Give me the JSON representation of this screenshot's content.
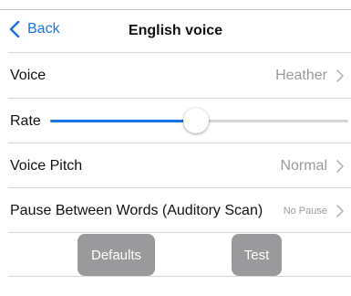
{
  "nav": {
    "back_label": "Back",
    "title": "English voice"
  },
  "rows": [
    {
      "label": "Voice",
      "value": "Heather"
    },
    {
      "label": "Rate"
    },
    {
      "label": "Voice Pitch",
      "value": "Normal"
    },
    {
      "label": "Pause Between Words (Auditory Scan)",
      "value": "No Pause"
    }
  ],
  "rate_slider": {
    "fraction": 0.49
  },
  "buttons": {
    "defaults_label": "Defaults",
    "test_label": "Test"
  },
  "colors": {
    "accent": "#1a73e8",
    "button_bg": "#9a9a9d",
    "value_gray": "#9a9a9a"
  },
  "icons": {
    "back": "chevron-left-icon",
    "disclosure": "chevron-right-icon"
  }
}
